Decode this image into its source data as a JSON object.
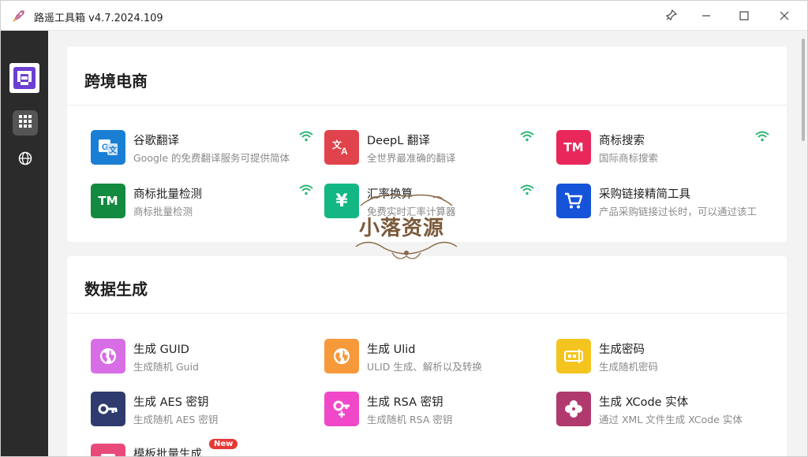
{
  "window": {
    "title": "路遥工具箱 v4.7.2024.109"
  },
  "sidebar": {
    "items": [
      {
        "icon": "grid-icon"
      },
      {
        "icon": "globe-icon"
      }
    ]
  },
  "sections": [
    {
      "title": "跨境电商",
      "tools": [
        {
          "name": "谷歌翻译",
          "desc": "Google 的免费翻译服务可提供简体",
          "icon_text": "G",
          "color": "#1a7fd4",
          "online": true
        },
        {
          "name": "DeepL 翻译",
          "desc": "全世界最准确的翻译",
          "icon_text": "文A",
          "color": "#e0434b",
          "online": true
        },
        {
          "name": "商标搜索",
          "desc": "国际商标搜索",
          "icon_text": "TM",
          "color": "#e8285a",
          "online": true
        },
        {
          "name": "商标批量检测",
          "desc": "商标批量检测",
          "icon_text": "TM",
          "color": "#128a3f",
          "online": true
        },
        {
          "name": "汇率换算",
          "desc": "免费实时汇率计算器",
          "icon_text": "¥",
          "color": "#13b783",
          "online": true
        },
        {
          "name": "采购链接精简工具",
          "desc": "产品采购链接过长时，可以通过该工",
          "icon_text": "cart",
          "color": "#1553d8",
          "online": false
        }
      ]
    },
    {
      "title": "数据生成",
      "tools": [
        {
          "name": "生成 GUID",
          "desc": "生成随机 Guid",
          "icon_text": "globe",
          "color": "#d86ee6",
          "online": false
        },
        {
          "name": "生成 Ulid",
          "desc": "ULID 生成、解析以及转换",
          "icon_text": "globe",
          "color": "#f6993b",
          "online": false
        },
        {
          "name": "生成密码",
          "desc": "生成随机密码",
          "icon_text": "pwd",
          "color": "#f5c51f",
          "online": false
        },
        {
          "name": "生成 AES 密钥",
          "desc": "生成随机 AES 密钥",
          "icon_text": "key",
          "color": "#2f3b6e",
          "online": false
        },
        {
          "name": "生成 RSA 密钥",
          "desc": "生成随机 RSA 密钥",
          "icon_text": "key",
          "color": "#f048c8",
          "online": false
        },
        {
          "name": "生成 XCode 实体",
          "desc": "通过 XML 文件生成 XCode 实体",
          "icon_text": "x",
          "color": "#b03a6e",
          "online": false
        },
        {
          "name": "模板批量生成",
          "desc": "",
          "icon_text": "tpl",
          "color": "#e84a7a",
          "online": false,
          "badge": "New"
        }
      ]
    }
  ],
  "watermark": {
    "text": "小落资源"
  }
}
